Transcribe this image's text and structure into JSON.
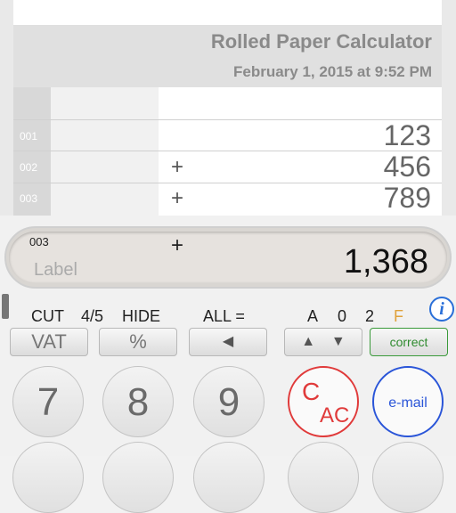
{
  "tape": {
    "title": "Rolled Paper Calculator",
    "datetime": "February 1, 2015 at 9:52 PM",
    "rows": [
      {
        "num": "001",
        "op": "",
        "value": "123"
      },
      {
        "num": "002",
        "op": "+",
        "value": "456"
      },
      {
        "num": "003",
        "op": "+",
        "value": "789"
      }
    ]
  },
  "display": {
    "line_number": "003",
    "operator": "+",
    "label_placeholder": "Label",
    "value": "1,368"
  },
  "function_row": {
    "cut": "CUT",
    "rounding": "4/5",
    "hide": "HIDE",
    "all_eq": "ALL =",
    "mode_a": "A",
    "mode_0": "0",
    "mode_2": "2",
    "mode_f": "F"
  },
  "buttons": {
    "vat": "VAT",
    "percent": "%",
    "back": "◀",
    "up": "▲",
    "down": "▼",
    "correct": "correct"
  },
  "keys": {
    "seven": "7",
    "eight": "8",
    "nine": "9",
    "c": "C",
    "ac": "AC",
    "email": "e-mail"
  },
  "colors": {
    "accent_blue": "#2a6fd8",
    "clear_red": "#e03a3a",
    "correct_green": "#3a9a3a",
    "mode_orange": "#e0a23c"
  },
  "icons": {
    "info": "info-icon"
  }
}
